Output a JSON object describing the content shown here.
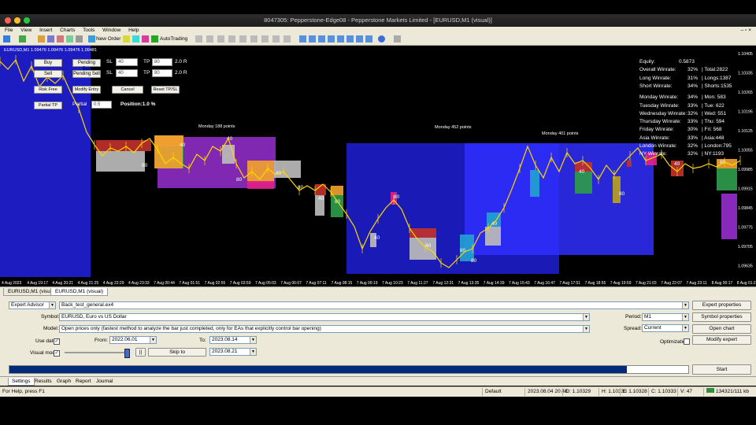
{
  "window": {
    "title": "8047305: Pepperstone-Edge08 - Pepperstone Markets Limited - [EURUSD,M1 (visual)]"
  },
  "menu": [
    "File",
    "View",
    "Insert",
    "Charts",
    "Tools",
    "Window",
    "Help"
  ],
  "toolbar": {
    "new_order": "New Order",
    "autotrading": "AutoTrading"
  },
  "chart": {
    "header": "EURUSD,M1  1.09476  1.09476  1.09476  1.09481",
    "controls": {
      "buy": "Buy",
      "sell": "Sell",
      "pending_buy": "Pending Buy",
      "pending_sell": "Pending Sell",
      "sl_label": "SL",
      "tp_label": "TP",
      "sl_buy_value": "40",
      "tp_buy_value": "80",
      "sl_sell_value": "40",
      "tp_sell_value": "80",
      "rr_buy": "2.0 R",
      "rr_sell": "2.0 R",
      "risk_free": "Risk Free",
      "modify_entry": "Modify Entry",
      "cancel_pending": "Cancel Pending",
      "reset_tpsl": "Reset TP/SL",
      "partial_tp": "Partial TP",
      "partial_label": "Partial",
      "partial_value": "0.5",
      "position": "Position:1.0 %"
    },
    "stats": [
      {
        "label": "Equity:",
        "value": "0.5873"
      },
      {
        "label": "Overall Winrate:",
        "value": "32%",
        "extra": "| Total:2822"
      },
      {
        "label": "Long Winrate:",
        "value": "31%",
        "extra": "| Longs:1387"
      },
      {
        "label": "Short Winrate:",
        "value": "34%",
        "extra": "| Shorts:1535"
      },
      {
        "label": "Monday Winrate:",
        "value": "34%",
        "extra": "| Mon: 583"
      },
      {
        "label": "Tuesday Winrate:",
        "value": "33%",
        "extra": "| Tue: 622"
      },
      {
        "label": "Wednesday Winrate:",
        "value": "32%",
        "extra": "| Wed: 551"
      },
      {
        "label": "Thursday Winrate:",
        "value": "33%",
        "extra": "| Thu: 594"
      },
      {
        "label": "Friday Winrate:",
        "value": "30%",
        "extra": "| Fri: 568"
      },
      {
        "label": "Asia Winrate:",
        "value": "33%",
        "extra": "| Asia:448"
      },
      {
        "label": "London Winrate:",
        "value": "32%",
        "extra": "| London:795"
      },
      {
        "label": "NY Winrate:",
        "value": "32%",
        "extra": "| NY:1193"
      }
    ],
    "annotations": [
      "Monday 188 points",
      "Monday 452 points",
      "Monday 401 points"
    ],
    "box_labels": [
      "40",
      "80"
    ],
    "price_ticks": [
      "1.10405",
      "1.10335",
      "1.10265",
      "1.10195",
      "1.10125",
      "1.10055",
      "1.09985",
      "1.09915",
      "1.09845",
      "1.09775",
      "1.09705",
      "1.09635"
    ],
    "time_ticks": [
      "4 Aug 2023",
      "4 Aug 19:17",
      "4 Aug 20:21",
      "4 Aug 21:25",
      "4 Aug 22:29",
      "4 Aug 23:33",
      "7 Aug 00:44",
      "7 Aug 01:51",
      "7 Aug 02:55",
      "7 Aug 03:59",
      "7 Aug 05:03",
      "7 Aug 06:07",
      "7 Aug 07:11",
      "7 Aug 08:15",
      "7 Aug 09:19",
      "7 Aug 10:23",
      "7 Aug 11:27",
      "7 Aug 12:31",
      "7 Aug 13:35",
      "7 Aug 14:39",
      "7 Aug 15:43",
      "7 Aug 16:47",
      "7 Aug 17:51",
      "7 Aug 18:55",
      "7 Aug 19:59",
      "7 Aug 21:03",
      "7 Aug 22:07",
      "7 Aug 23:11",
      "8 Aug 00:17",
      "8 Aug 01:21"
    ],
    "colors": {
      "background": "#000000",
      "candle": "#ffd700",
      "session_blue": "#1f1fd6",
      "session_purple": "#8e2cc4"
    }
  },
  "chart_tabs": [
    "EURUSD,M1 (visual)",
    "EURUSD,M1 (visual)"
  ],
  "tester": {
    "type": "Expert Advisor",
    "expert": "Back_test_general.ex4",
    "symbol_label": "Symbol:",
    "symbol": "EURUSD, Euro vs US Dollar",
    "model_label": "Model:",
    "model": "Open prices only (fastest method to analyze the bar just completed, only for EAs that explicitly control bar opening)",
    "use_date": "Use date",
    "from_label": "From:",
    "from": "2022.06.01",
    "to_label": "To:",
    "to": "2023.08.14",
    "visual_mode": "Visual mode",
    "pause": "||",
    "skip_to": "Skip to",
    "skip_date": "2023.08.21",
    "period_label": "Period:",
    "period": "M1",
    "spread_label": "Spread:",
    "spread": "Current",
    "optimization": "Optimization",
    "expert_properties": "Expert properties",
    "symbol_properties": "Symbol properties",
    "open_chart": "Open chart",
    "modify_expert": "Modify expert",
    "start": "Start",
    "progress": 0.91
  },
  "bottom_tabs": [
    "Settings",
    "Results",
    "Graph",
    "Report",
    "Journal"
  ],
  "status": {
    "help": "For Help, press F1",
    "profile": "Default",
    "time": "2023.08.04 20:48",
    "open": "O: 1.10329",
    "high": "H: 1.10335",
    "low": "L: 1.10328",
    "close": "C: 1.10333",
    "volume": "V: 47",
    "traffic": "134321/111 kb"
  }
}
